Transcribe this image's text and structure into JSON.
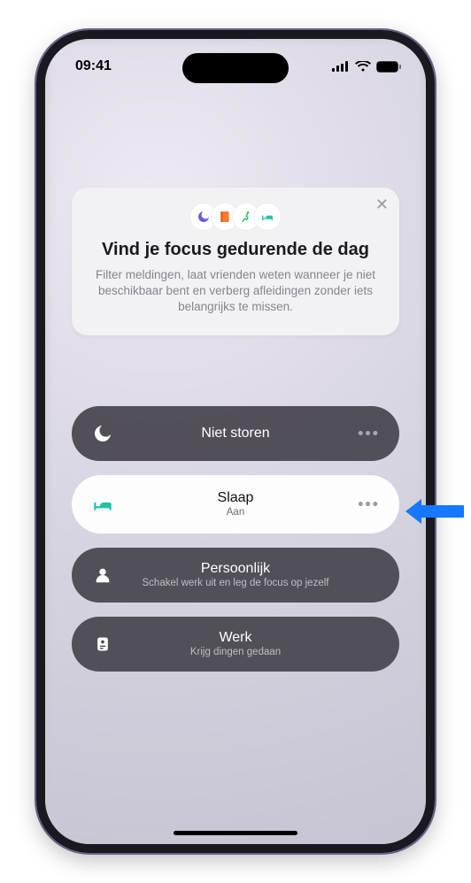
{
  "statusbar": {
    "time": "09:41"
  },
  "card": {
    "title": "Vind je focus gedurende de dag",
    "body": "Filter meldingen, laat vrienden weten wanneer je niet beschikbaar bent en verberg afleidingen zonder iets belangrijks te missen.",
    "close": "✕"
  },
  "focus": {
    "dnd": {
      "label": "Niet storen"
    },
    "sleep": {
      "label": "Slaap",
      "sub": "Aan"
    },
    "personal": {
      "label": "Persoonlijk",
      "sub": "Schakel werk uit en leg de focus op jezelf"
    },
    "work": {
      "label": "Werk",
      "sub": "Krijg dingen gedaan"
    },
    "more": "•••"
  }
}
